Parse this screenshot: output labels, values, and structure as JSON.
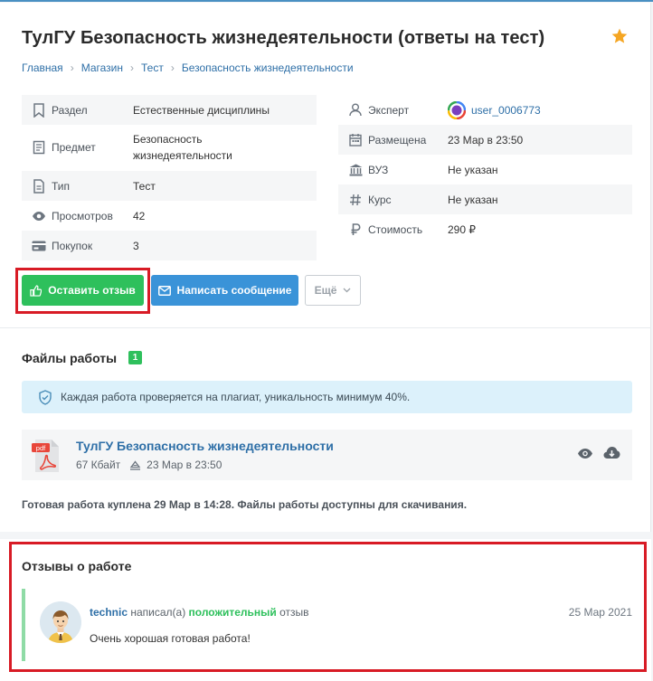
{
  "page": {
    "title": "ТулГУ Безопасность жизнедеятельности (ответы на тест)",
    "breadcrumbs": [
      "Главная",
      "Магазин",
      "Тест",
      "Безопасность жизнедеятельности"
    ]
  },
  "info_left": [
    {
      "icon": "bookmark-icon",
      "label": "Раздел",
      "value": "Естественные дисциплины"
    },
    {
      "icon": "book-icon",
      "label": "Предмет",
      "value": "Безопасность жизнедеятельности"
    },
    {
      "icon": "document-icon",
      "label": "Тип",
      "value": "Тест"
    },
    {
      "icon": "eye-icon",
      "label": "Просмотров",
      "value": "42"
    },
    {
      "icon": "card-icon",
      "label": "Покупок",
      "value": "3"
    }
  ],
  "info_right": [
    {
      "icon": "user-icon",
      "label": "Эксперт",
      "value": "user_0006773"
    },
    {
      "icon": "calendar-icon",
      "label": "Размещена",
      "value": "23 Мар в 23:50"
    },
    {
      "icon": "university-icon",
      "label": "ВУЗ",
      "value": "Не указан"
    },
    {
      "icon": "hash-icon",
      "label": "Курс",
      "value": "Не указан"
    },
    {
      "icon": "ruble-icon",
      "label": "Стоимость",
      "value": "290 ₽"
    }
  ],
  "buttons": {
    "review": "Оставить отзыв",
    "message": "Написать сообщение",
    "more": "Ещё"
  },
  "files": {
    "title": "Файлы работы",
    "count": "1",
    "notice": "Каждая работа проверяется на плагиат, уникальность минимум 40%.",
    "file_name": "ТулГУ Безопасность жизнедеятельности",
    "file_size": "67 Кбайт",
    "file_date": "23 Мар в 23:50",
    "file_type": "pdf",
    "purchased": "Готовая работа куплена 29 Мар в 14:28. Файлы работы доступны для скачивания."
  },
  "reviews": {
    "title": "Отзывы о работе",
    "user": "technic",
    "wrote": "написал(а)",
    "sentiment": "положительный",
    "suffix": "отзыв",
    "date": "25 Мар 2021",
    "text": "Очень хорошая готовая работа!"
  },
  "colors": {
    "accent_green": "#2ec05c",
    "accent_blue": "#3a93d8",
    "link": "#2e6fa7",
    "highlight_red": "#d81b25"
  }
}
